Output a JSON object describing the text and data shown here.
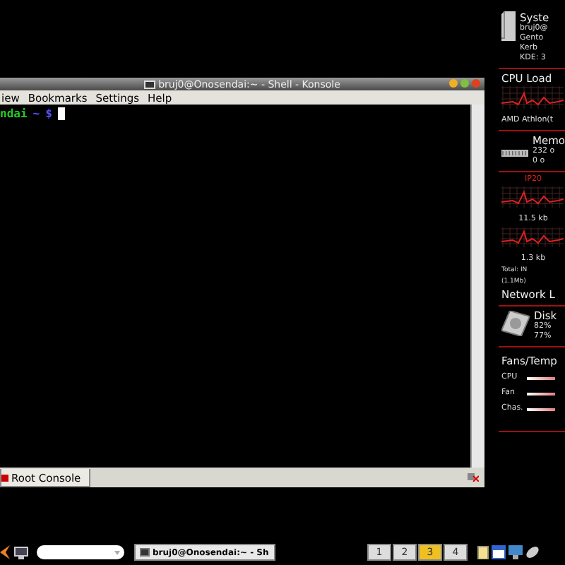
{
  "konsole": {
    "title": "bruj0@Onosendai:~ - Shell - Konsole",
    "menu": [
      "iew",
      "Bookmarks",
      "Settings",
      "Help"
    ],
    "prompt": {
      "host": "ndai",
      "path": "~",
      "symbol": "$"
    },
    "tabs": [
      {
        "label": "Root Console",
        "selected": true
      }
    ]
  },
  "monitor": {
    "system": {
      "title": "Syste",
      "lines": [
        "bruj0@",
        "Gento",
        "Kerb",
        "KDE: 3"
      ]
    },
    "cpu": {
      "title": "CPU Load",
      "model": "AMD Athlon(t"
    },
    "memory": {
      "title": "Memo",
      "lines": [
        "232 o",
        "0    o"
      ]
    },
    "network": {
      "ip": "IP20",
      "down": "11.5 kb",
      "up": "1.3 kb",
      "total": [
        "Total: IN",
        "(1.1Mb)"
      ],
      "title": "Network L"
    },
    "disk": {
      "title": "Disk",
      "lines": [
        "82%",
        "77%"
      ]
    },
    "fans": {
      "title": "Fans/Temp",
      "items": [
        "CPU",
        "Fan",
        "Chas."
      ]
    }
  },
  "taskbar": {
    "task": "bruj0@Onosendai:~ - Sh",
    "desktops": [
      {
        "label": "1",
        "selected": false
      },
      {
        "label": "2",
        "selected": false
      },
      {
        "label": "3",
        "selected": true
      },
      {
        "label": "4",
        "selected": false
      }
    ]
  }
}
